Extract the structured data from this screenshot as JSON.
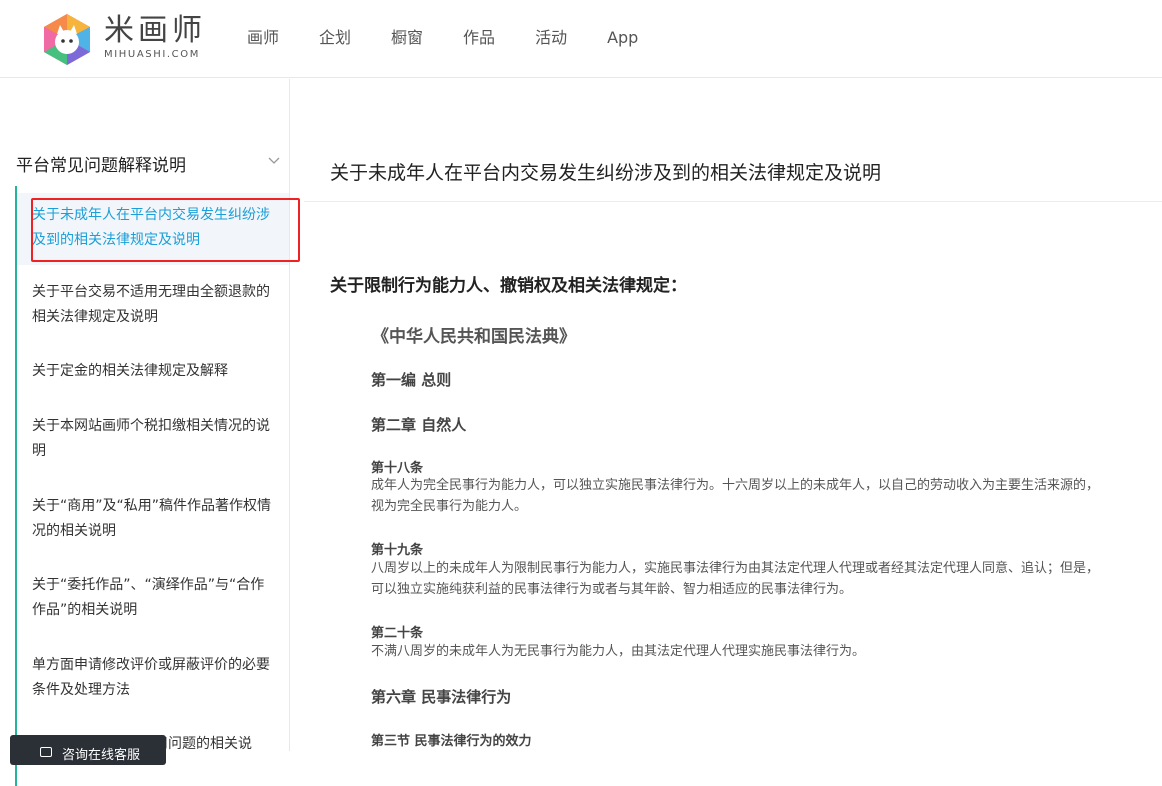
{
  "brand": {
    "name": "米画师",
    "domain": "MIHUASHI.COM"
  },
  "nav": [
    "画师",
    "企划",
    "橱窗",
    "作品",
    "活动",
    "App"
  ],
  "sidebar": {
    "title": "平台常见问题解释说明",
    "items": [
      {
        "label": "关于未成年人在平台内交易发生纠纷涉及到的相关法律规定及说明",
        "active": true
      },
      {
        "label": "关于平台交易不适用无理由全额退款的相关法律规定及说明"
      },
      {
        "label": "关于定金的相关法律规定及解释"
      },
      {
        "label": "关于本网站画师个税扣缴相关情况的说明"
      },
      {
        "label": "关于“商用”及“私用”稿件作品著作权情况的相关说明"
      },
      {
        "label": "关于“委托作品”、“演绎作品”与“合作作品”的相关说明"
      },
      {
        "label": "单方面申请修改评价或屏蔽评价的必要条件及处理方法"
      },
      {
        "label": "用问题的相关说"
      }
    ],
    "chat_label": "咨询在线客服"
  },
  "main": {
    "title": "关于未成年人在平台内交易发生纠纷涉及到的相关法律规定及说明",
    "section_title": "关于限制行为能力人、撤销权及相关法律规定：",
    "law_title": "《中华人民共和国民法典》",
    "part": "第一编 总则",
    "chapter2": "第二章 自然人",
    "art18_title": "第十八条",
    "art18_text": "成年人为完全民事行为能力人，可以独立实施民事法律行为。十六周岁以上的未成年人，以自己的劳动收入为主要生活来源的，视为完全民事行为能力人。",
    "art19_title": "第十九条",
    "art19_text": "八周岁以上的未成年人为限制民事行为能力人，实施民事法律行为由其法定代理人代理或者经其法定代理人同意、追认；但是，可以独立实施纯获利益的民事法律行为或者与其年龄、智力相适应的民事法律行为。",
    "art20_title": "第二十条",
    "art20_text": "不满八周岁的未成年人为无民事行为能力人，由其法定代理人代理实施民事法律行为。",
    "chapter6": "第六章 民事法律行为",
    "section3": "第三节 民事法律行为的效力"
  },
  "colors": {
    "accent": "#26b39b",
    "active_link": "#1a9fd9",
    "highlight": "#ee2222"
  }
}
